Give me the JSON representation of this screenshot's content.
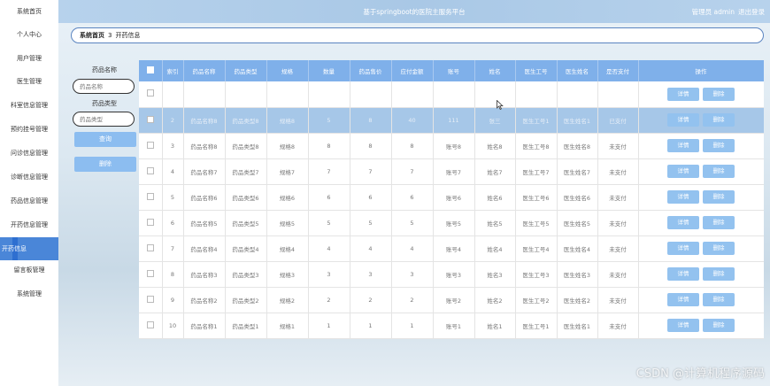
{
  "header": {
    "title": "基于springboot的医院主服务平台",
    "user_label": "管理员 admin",
    "logout_label": "退出登录"
  },
  "sidebar": {
    "items": [
      {
        "label": "系统首页"
      },
      {
        "label": "个人中心"
      },
      {
        "label": "用户管理"
      },
      {
        "label": "医生管理"
      },
      {
        "label": "科室信息管理"
      },
      {
        "label": "预约挂号管理"
      },
      {
        "label": "问诊信息管理"
      },
      {
        "label": "诊断信息管理"
      },
      {
        "label": "药品信息管理"
      },
      {
        "label": "开药信息管理"
      },
      {
        "label": "开药信息"
      },
      {
        "label": "留言板管理"
      },
      {
        "label": "系统管理"
      }
    ],
    "active_index": 10
  },
  "breadcrumb": {
    "home": "系统首页",
    "separator": "3",
    "current": "开药信息"
  },
  "search": {
    "drug_name_label": "药品名称",
    "drug_name_placeholder": "药品名称",
    "drug_type_label": "药品类型",
    "drug_type_placeholder": "药品类型",
    "query_button": "查询",
    "delete_button": "删除"
  },
  "table": {
    "columns": [
      "索引",
      "药品名称",
      "药品类型",
      "规格",
      "数量",
      "药品售价",
      "应付金额",
      "账号",
      "姓名",
      "医生工号",
      "医生姓名",
      "是否支付",
      "操作"
    ],
    "rows": [
      [
        "",
        "",
        "",
        "",
        "",
        "",
        "",
        "",
        "",
        "",
        "",
        ""
      ],
      [
        "2",
        "药品名称8",
        "药品类型8",
        "规格8",
        "5",
        "8",
        "40",
        "111",
        "张三",
        "医生工号1",
        "医生姓名1",
        "已支付"
      ],
      [
        "3",
        "药品名称8",
        "药品类型8",
        "规格8",
        "8",
        "8",
        "8",
        "账号8",
        "姓名8",
        "医生工号8",
        "医生姓名8",
        "未支付"
      ],
      [
        "4",
        "药品名称7",
        "药品类型7",
        "规格7",
        "7",
        "7",
        "7",
        "账号7",
        "姓名7",
        "医生工号7",
        "医生姓名7",
        "未支付"
      ],
      [
        "5",
        "药品名称6",
        "药品类型6",
        "规格6",
        "6",
        "6",
        "6",
        "账号6",
        "姓名6",
        "医生工号6",
        "医生姓名6",
        "未支付"
      ],
      [
        "6",
        "药品名称5",
        "药品类型5",
        "规格5",
        "5",
        "5",
        "5",
        "账号5",
        "姓名5",
        "医生工号5",
        "医生姓名5",
        "未支付"
      ],
      [
        "7",
        "药品名称4",
        "药品类型4",
        "规格4",
        "4",
        "4",
        "4",
        "账号4",
        "姓名4",
        "医生工号4",
        "医生姓名4",
        "未支付"
      ],
      [
        "8",
        "药品名称3",
        "药品类型3",
        "规格3",
        "3",
        "3",
        "3",
        "账号3",
        "姓名3",
        "医生工号3",
        "医生姓名3",
        "未支付"
      ],
      [
        "9",
        "药品名称2",
        "药品类型2",
        "规格2",
        "2",
        "2",
        "2",
        "账号2",
        "姓名2",
        "医生工号2",
        "医生姓名2",
        "未支付"
      ],
      [
        "10",
        "药品名称1",
        "药品类型1",
        "规格1",
        "1",
        "1",
        "1",
        "账号1",
        "姓名1",
        "医生工号1",
        "医生姓名1",
        "未支付"
      ]
    ],
    "selected_row": 1,
    "detail_button": "详情",
    "delete_button": "删除"
  },
  "watermark": "CSDN @计算机程序源码",
  "colors": {
    "header": "#a9c8e6",
    "table_header": "#7fb0ea",
    "button": "#93c2ef",
    "active_sidebar": "#4a86d8"
  }
}
